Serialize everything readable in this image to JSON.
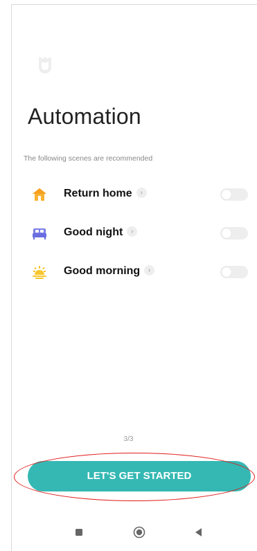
{
  "header": {
    "logo_icon": "mi-home-logo-icon",
    "title": "Automation",
    "subtitle": "The following scenes are recommended"
  },
  "scenes": [
    {
      "label": "Return home",
      "icon": "house-icon",
      "icon_color": "#f9b233",
      "enabled": false
    },
    {
      "label": "Good night",
      "icon": "bed-icon",
      "icon_color": "#7b7fe6",
      "enabled": false
    },
    {
      "label": "Good morning",
      "icon": "sunrise-icon",
      "icon_color": "#f7c62f",
      "enabled": false
    }
  ],
  "chevron_glyph": "›",
  "pager": {
    "text": "3/3"
  },
  "cta": {
    "label": "LET'S GET STARTED",
    "color": "#35b8b3"
  },
  "annotation": {
    "shape": "ellipse",
    "color": "#e01919",
    "target": "cta"
  },
  "navbar": {
    "buttons": [
      "recents-square-icon",
      "home-circle-icon",
      "back-triangle-icon"
    ]
  }
}
